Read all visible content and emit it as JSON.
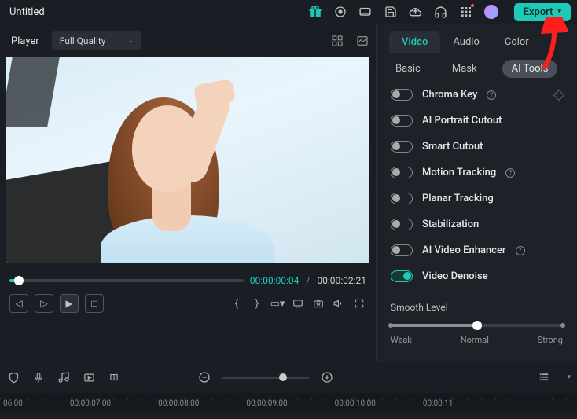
{
  "topbar": {
    "title": "Untitled",
    "export_label": "Export"
  },
  "player": {
    "label": "Player",
    "quality": "Full Quality",
    "time_current": "00:00:00:04",
    "time_sep": "/",
    "time_total": "00:00:02:21"
  },
  "right": {
    "tabs": [
      {
        "label": "Video",
        "active": true
      },
      {
        "label": "Audio",
        "active": false
      },
      {
        "label": "Color",
        "active": false
      }
    ],
    "subtabs": [
      {
        "label": "Basic",
        "active": false
      },
      {
        "label": "Mask",
        "active": false
      },
      {
        "label": "AI Tools",
        "active": true
      }
    ],
    "tools": [
      {
        "label": "Chroma Key",
        "on": false,
        "help": true,
        "keyframe": true
      },
      {
        "label": "AI Portrait Cutout",
        "on": false
      },
      {
        "label": "Smart Cutout",
        "on": false
      },
      {
        "label": "Motion Tracking",
        "on": false,
        "help": true
      },
      {
        "label": "Planar Tracking",
        "on": false
      },
      {
        "label": "Stabilization",
        "on": false
      },
      {
        "label": "AI Video Enhancer",
        "on": false,
        "help": true
      },
      {
        "label": "Video Denoise",
        "on": true
      }
    ],
    "smooth": {
      "title": "Smooth Level",
      "labels": [
        "Weak",
        "Normal",
        "Strong"
      ]
    }
  },
  "timeline": {
    "marks": [
      "06:00",
      "00:00:07:00",
      "00:00:08:00",
      "00:00:09:00",
      "00:00:10:00",
      "00:00:11"
    ]
  }
}
